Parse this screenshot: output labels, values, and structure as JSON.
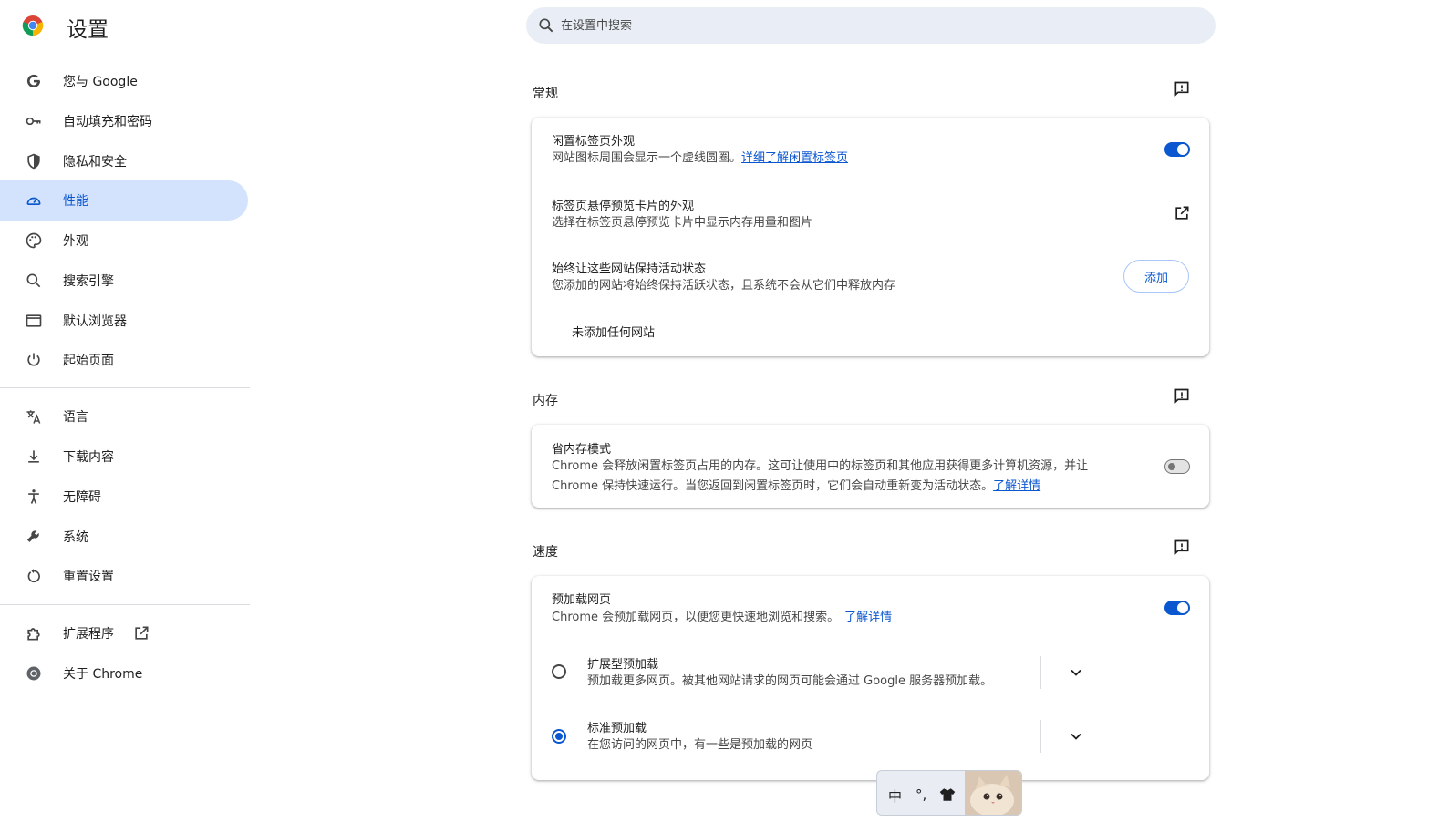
{
  "header": {
    "title": "设置"
  },
  "search": {
    "placeholder": "在设置中搜索"
  },
  "sidebar": {
    "items": [
      {
        "label": "您与 Google",
        "icon": "google-g-icon"
      },
      {
        "label": "自动填充和密码",
        "icon": "key-icon"
      },
      {
        "label": "隐私和安全",
        "icon": "shield-icon"
      },
      {
        "label": "性能",
        "icon": "speedometer-icon",
        "active": true
      },
      {
        "label": "外观",
        "icon": "palette-icon"
      },
      {
        "label": "搜索引擎",
        "icon": "search-icon"
      },
      {
        "label": "默认浏览器",
        "icon": "browser-window-icon"
      },
      {
        "label": "起始页面",
        "icon": "power-icon"
      },
      {
        "label": "语言",
        "icon": "translate-icon"
      },
      {
        "label": "下载内容",
        "icon": "download-icon"
      },
      {
        "label": "无障碍",
        "icon": "accessibility-icon"
      },
      {
        "label": "系统",
        "icon": "wrench-icon"
      },
      {
        "label": "重置设置",
        "icon": "reset-icon"
      },
      {
        "label": "扩展程序",
        "icon": "puzzle-icon"
      },
      {
        "label": "关于 Chrome",
        "icon": "chrome-icon"
      }
    ]
  },
  "sections": {
    "general": {
      "title": "常规",
      "inactive_tab": {
        "title": "闲置标签页外观",
        "desc": "网站图标周围会显示一个虚线圆圈。",
        "link": "详细了解闲置标签页",
        "enabled": true
      },
      "hover_card": {
        "title": "标签页悬停预览卡片的外观",
        "desc": "选择在标签页悬停预览卡片中显示内存用量和图片"
      },
      "always_active": {
        "title": "始终让这些网站保持活动状态",
        "desc": "您添加的网站将始终保持活跃状态，且系统不会从它们中释放内存",
        "button": "添加",
        "empty": "未添加任何网站"
      }
    },
    "memory": {
      "title": "内存",
      "saver": {
        "title": "省内存模式",
        "desc_line1": "Chrome 会释放闲置标签页占用的内存。这可让使用中的标签页和其他应用获得更多计算机资源，并让",
        "desc_line2": "Chrome 保持快速运行。当您返回到闲置标签页时，它们会自动重新变为活动状态。",
        "link": "了解详情",
        "enabled": false
      }
    },
    "speed": {
      "title": "速度",
      "preload": {
        "title": "预加载网页",
        "desc": "Chrome 会预加载网页，以便您更快速地浏览和搜索。",
        "link": "了解详情",
        "enabled": true
      },
      "extended": {
        "title": "扩展型预加载",
        "desc": "预加载更多网页。被其他网站请求的网页可能会通过 Google 服务器预加载。",
        "selected": false
      },
      "standard": {
        "title": "标准预加载",
        "desc": "在您访问的网页中，有一些是预加载的网页",
        "selected": true
      }
    }
  },
  "ime": {
    "mode": "中",
    "punct": "°,",
    "icon": "shirt-icon"
  },
  "colors": {
    "accent": "#0b57d0",
    "active_bg": "#d3e3fd",
    "search_bg": "#e9eef6"
  }
}
